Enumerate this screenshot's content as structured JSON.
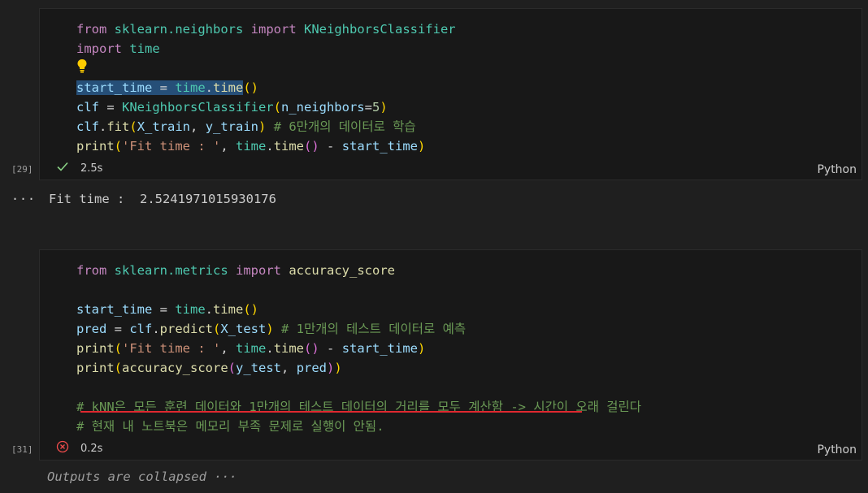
{
  "cell1": {
    "exec_count": "[29]",
    "lines": {
      "l1": {
        "a": "from",
        "b": "sklearn.neighbors",
        "c": "import",
        "d": "KNeighborsClassifier"
      },
      "l2": {
        "a": "import",
        "b": "time"
      },
      "l4": {
        "a": "start_time",
        "b": " = ",
        "c": "time",
        "d": ".",
        "e": "time",
        "f": "()"
      },
      "l5": {
        "a": "clf",
        "b": " = ",
        "c": "KNeighborsClassifier",
        "d": "(",
        "e": "n_neighbors",
        "f": "=",
        "g": "5",
        "h": ")"
      },
      "l6": {
        "a": "clf",
        "b": ".",
        "c": "fit",
        "d": "(",
        "e": "X_train",
        "f": ", ",
        "g": "y_train",
        "h": ")",
        "i": " # 6만개의 데이터로 학습"
      },
      "l7": {
        "a": "print",
        "b": "(",
        "c": "'Fit time : '",
        "d": ", ",
        "e": "time",
        "f": ".",
        "g": "time",
        "h": "()",
        "i": " - ",
        "j": "start_time",
        "k": ")"
      }
    },
    "status_time": "2.5s",
    "language": "Python"
  },
  "output1": {
    "more": "···",
    "text": "Fit time :  2.5241971015930176"
  },
  "cell2": {
    "exec_count": "[31]",
    "lines": {
      "l1": {
        "a": "from",
        "b": "sklearn.metrics",
        "c": "import",
        "d": "accuracy_score"
      },
      "l3": {
        "a": "start_time",
        "b": " = ",
        "c": "time",
        "d": ".",
        "e": "time",
        "f": "()"
      },
      "l4": {
        "a": "pred",
        "b": " = ",
        "c": "clf",
        "d": ".",
        "e": "predict",
        "f": "(",
        "g": "X_test",
        "h": ")",
        "i": " # 1만개의 테스트 데이터로 예측"
      },
      "l5": {
        "a": "print",
        "b": "(",
        "c": "'Fit time : '",
        "d": ", ",
        "e": "time",
        "f": ".",
        "g": "time",
        "h": "()",
        "i": " - ",
        "j": "start_time",
        "k": ")"
      },
      "l6": {
        "a": "print",
        "b": "(",
        "c": "accuracy_score",
        "d": "(",
        "e": "y_test",
        "f": ", ",
        "g": "pred",
        "h": ")",
        "i": ")"
      },
      "l8": "# kNN은 모든 훈련 데이터와 1만개의 테스트 데이터의 거리를 모두 계산함 -> 시간이 오래 걸린다",
      "l9": "# 현재 내 노트북은 메모리 부족 문제로 실행이 안됨."
    },
    "status_time": "0.2s",
    "language": "Python"
  },
  "collapsed_text": "Outputs are collapsed ···",
  "colors": {
    "keyword": "#c586c0",
    "module": "#4ec9b0",
    "function": "#dcdcaa",
    "variable": "#9cdcfe",
    "comment": "#6a9955",
    "string": "#ce9178",
    "success": "#89d185",
    "error": "#f14c4c",
    "underline": "#e0282f"
  },
  "icons": {
    "success": "check-icon",
    "error": "error-circle-icon",
    "hint": "lightbulb-icon"
  }
}
